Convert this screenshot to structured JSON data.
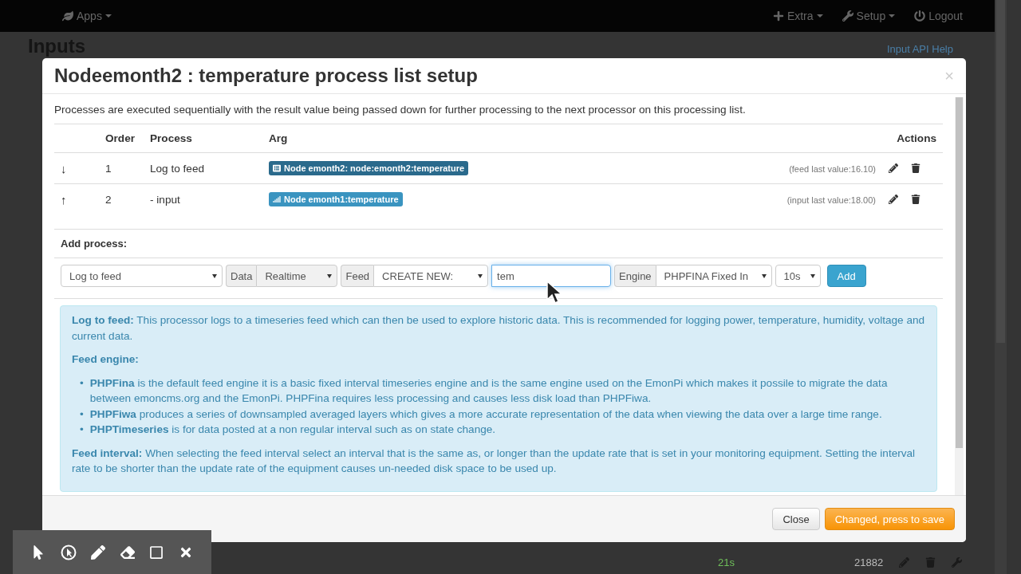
{
  "navbar": {
    "left": [
      {
        "label": "Apps"
      }
    ],
    "right": [
      {
        "label": "Extra",
        "caret": true
      },
      {
        "label": "Setup",
        "caret": true
      },
      {
        "label": "Logout",
        "caret": false
      }
    ]
  },
  "page": {
    "title": "Inputs",
    "help_link": "Input API Help",
    "footer_row": {
      "updated": "21s",
      "value": "21882"
    }
  },
  "modal": {
    "title": "Nodeemonth2 : temperature process list setup",
    "intro": "Processes are executed sequentially with the result value being passed down for further processing to the next processor on this processing list.",
    "table": {
      "columns": [
        "",
        "Order",
        "Process",
        "Arg",
        "",
        "Actions"
      ],
      "rows": [
        {
          "move": "↓",
          "order": "1",
          "process": "Log to feed",
          "arg": {
            "kind": "feed",
            "label": "Node emonth2: node:emonth2:temperature"
          },
          "last_value": "(feed last value:16.10)"
        },
        {
          "move": "↑",
          "order": "2",
          "process": "- input",
          "arg": {
            "kind": "input",
            "label": "Node emonth1:temperature"
          },
          "last_value": "(input last value:18.00)"
        }
      ]
    },
    "add_process": {
      "title": "Add process:",
      "process": "Log to feed",
      "data_label": "Data",
      "data": "Realtime",
      "feed_label": "Feed",
      "feed": "CREATE NEW:",
      "feed_name": "tem",
      "engine_label": "Engine",
      "engine": "PHPFINA Fixed In",
      "interval": "10s",
      "add_button": "Add"
    },
    "info": [
      {
        "kind": "paragraph",
        "text": "**Log to feed:** This processor logs to a timeseries feed which can then be used to explore historic data. This is recommended for logging power, temperature, humidity, voltage and current data."
      },
      {
        "kind": "heading",
        "text": "Feed engine:"
      },
      {
        "kind": "list",
        "marker": "•",
        "items": [
          "**PHPFina** is the default feed engine it is a basic fixed interval timeseries engine and is the same engine used on the EmonPi which makes it possile to migrate the data between emoncms.org and the EmonPi. PHPFina requires less processing and causes less disk load than PHPFiwa.",
          "**PHPFiwa** produces a series of downsampled averaged layers which gives a more accurate representation of the data when viewing the data over a large time range.",
          "**PHPTimeseries** is for data posted at a non regular interval such as on state change."
        ]
      },
      {
        "kind": "paragraph",
        "text": "**Feed interval:** When selecting the feed interval select an interval that is the same as, or longer than the update rate that is set in your monitoring equipment. Setting the interval rate to be shorter than the update rate of the equipment causes un-needed disk space to be used up."
      }
    ],
    "close_symbol": "×",
    "buttons": [
      {
        "kind": "default",
        "label": "Close"
      },
      {
        "kind": "warning",
        "label": "Changed, press to save"
      }
    ]
  }
}
